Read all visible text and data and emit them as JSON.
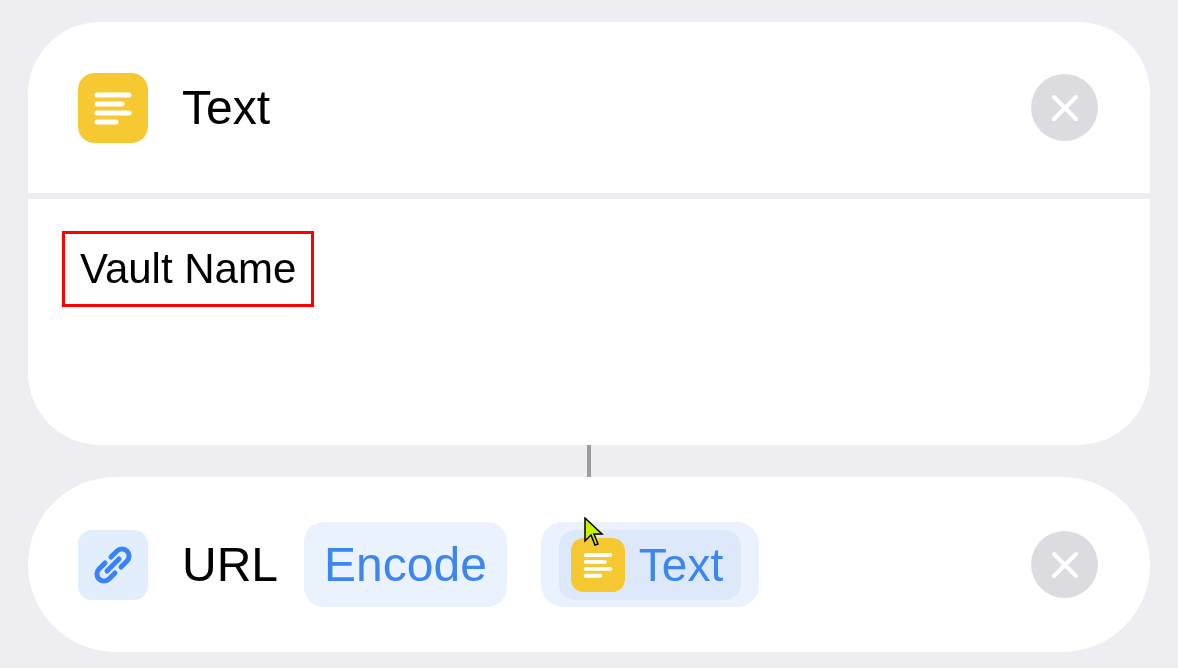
{
  "actions": [
    {
      "kind": "text",
      "title": "Text",
      "content": "Vault Name",
      "content_highlighted": true
    },
    {
      "kind": "url_encode",
      "title": "URL",
      "mode": "Encode",
      "variable": "Text"
    }
  ]
}
